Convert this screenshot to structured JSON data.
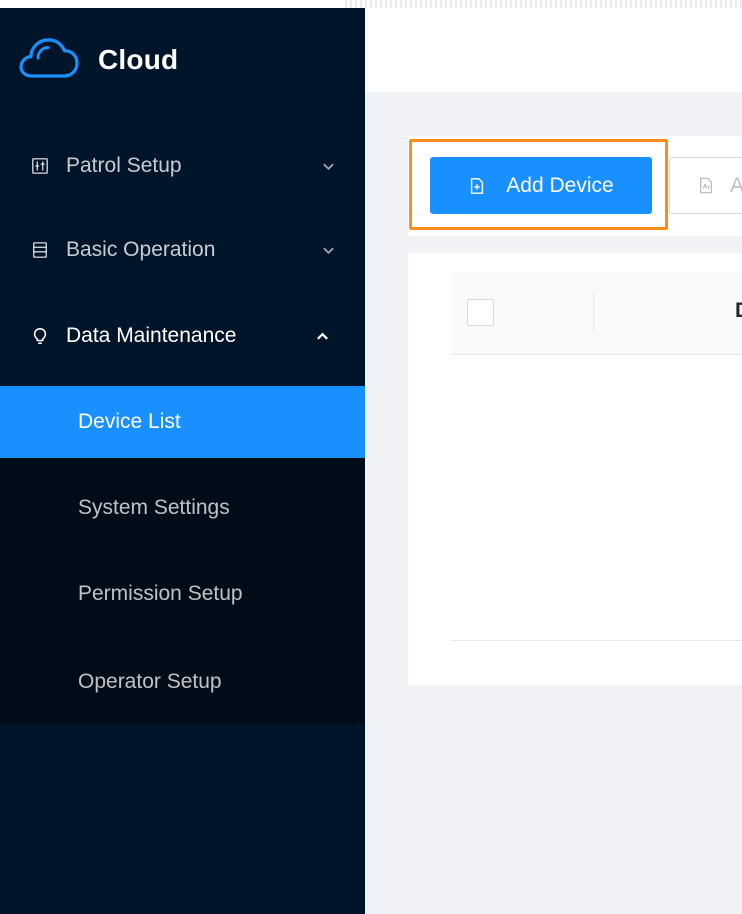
{
  "app": {
    "name": "Cloud"
  },
  "sidebar": {
    "menus": [
      {
        "label": "Patrol Setup",
        "icon": "patrol-setup-icon",
        "expanded": false
      },
      {
        "label": "Basic Operation",
        "icon": "basic-operation-icon",
        "expanded": false
      },
      {
        "label": "Data Maintenance",
        "icon": "lightbulb-icon",
        "expanded": true
      }
    ],
    "submenu": [
      {
        "label": "Device List",
        "active": true
      },
      {
        "label": "System Settings",
        "active": false
      },
      {
        "label": "Permission Setup",
        "active": false
      },
      {
        "label": "Operator Setup",
        "active": false
      }
    ]
  },
  "toolbar": {
    "add_device_label": "Add Device",
    "secondary_label": "A"
  },
  "table": {
    "first_column_header": "D"
  },
  "colors": {
    "sidebar_bg": "#001529",
    "submenu_bg": "#000c17",
    "accent": "#1890ff",
    "highlight": "#ff8c1a",
    "content_bg": "#f0f2f5"
  }
}
